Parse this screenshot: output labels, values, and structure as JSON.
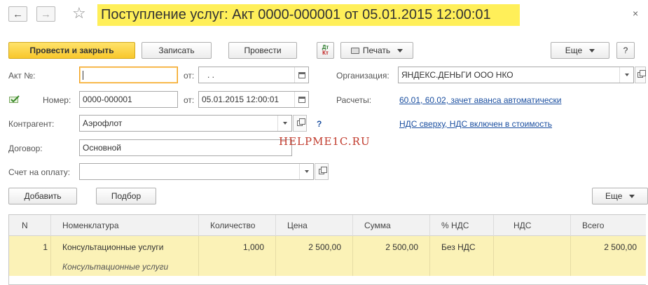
{
  "header": {
    "back_icon": "arrow-left-icon",
    "forward_icon": "arrow-right-icon",
    "title": "Поступление услуг: Акт 0000-000001 от 05.01.2015 12:00:01",
    "close_glyph": "×"
  },
  "toolbar": {
    "post_close": "Провести и закрыть",
    "save": "Записать",
    "post": "Провести",
    "dtkt_top": "Дт",
    "dtkt_bottom": "Кт",
    "print": "Печать",
    "more": "Еще",
    "help": "?"
  },
  "form": {
    "act_label": "Акт №:",
    "act_value": "",
    "from_label": "от:",
    "act_date": " .  .",
    "number_label": "Номер:",
    "number_value": "0000-000001",
    "date_value": "05.01.2015 12:00:01",
    "counterparty_label": "Контрагент:",
    "counterparty_value": "Аэрофлот",
    "contract_label": "Договор:",
    "contract_value": "Основной",
    "invoice_label": "Счет на оплату:",
    "invoice_value": "",
    "org_label": "Организация:",
    "org_value": "ЯНДЕКС.ДЕНЬГИ ООО НКО",
    "settlements_label": "Расчеты:",
    "settlements_link": "60.01, 60.02, зачет аванса автоматически",
    "vat_link": "НДС сверху, НДС включен в стоимость",
    "help_mark": "?"
  },
  "watermark": "HELPME1C.RU",
  "table_toolbar": {
    "add": "Добавить",
    "pick": "Подбор",
    "more": "Еще"
  },
  "table": {
    "columns": [
      "N",
      "Номенклатура",
      "Количество",
      "Цена",
      "Сумма",
      "% НДС",
      "НДС",
      "Всего"
    ],
    "rows": [
      {
        "n": "1",
        "item": "Консультационные услуги",
        "item_sub": "Консультационные услуги",
        "qty": "1,000",
        "price": "2 500,00",
        "sum": "2 500,00",
        "vat_rate": "Без НДС",
        "vat": "",
        "total": "2 500,00"
      }
    ]
  },
  "colors": {
    "title_bg": "#ffef59",
    "primary_button": "#f8c72b",
    "row_highlight": "#fbf2b7",
    "link": "#1b4fa0",
    "watermark": "#c0392b"
  }
}
